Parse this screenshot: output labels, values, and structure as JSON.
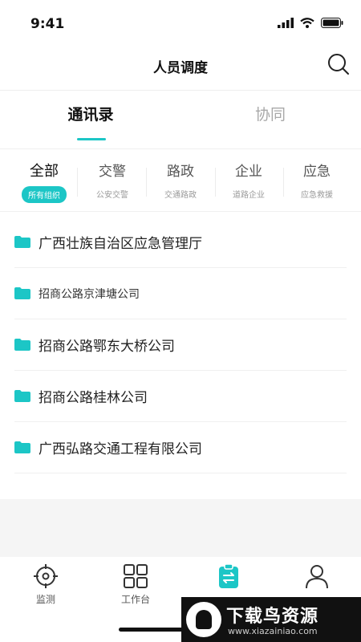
{
  "status_bar": {
    "time": "9:41"
  },
  "header": {
    "title": "人员调度"
  },
  "tabs": [
    {
      "label": "通讯录",
      "active": true
    },
    {
      "label": "协同",
      "active": false
    }
  ],
  "categories": [
    {
      "name": "全部",
      "sub": "所有组织",
      "active": true
    },
    {
      "name": "交警",
      "sub": "公安交警",
      "active": false
    },
    {
      "name": "路政",
      "sub": "交通路政",
      "active": false
    },
    {
      "name": "企业",
      "sub": "道路企业",
      "active": false
    },
    {
      "name": "应急",
      "sub": "应急救援",
      "active": false
    }
  ],
  "orgs": [
    {
      "name": "广西壮族自治区应急管理厅"
    },
    {
      "name": "招商公路京津塘公司"
    },
    {
      "name": "招商公路鄂东大桥公司"
    },
    {
      "name": "招商公路桂林公司"
    },
    {
      "name": "广西弘路交通工程有限公司"
    }
  ],
  "bottom_nav": [
    {
      "label": "监测",
      "icon": "target-icon"
    },
    {
      "label": "工作台",
      "icon": "grid-icon"
    },
    {
      "label": "",
      "icon": "clipboard-icon",
      "active": true
    },
    {
      "label": "",
      "icon": "user-icon"
    }
  ],
  "watermark": {
    "title": "下载鸟资源",
    "url": "www.xiazainiao.com"
  },
  "colors": {
    "accent": "#1cc6c6",
    "text": "#222222",
    "muted": "#a8a8a8",
    "grey_bg": "#f5f5f5"
  }
}
